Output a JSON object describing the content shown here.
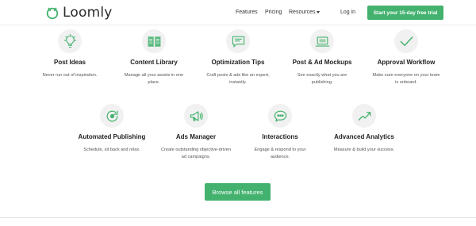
{
  "brand": {
    "name": "Loomly",
    "accent": "#43b26e"
  },
  "nav": {
    "features": "Features",
    "pricing": "Pricing",
    "resources": "Resources",
    "login": "Log in",
    "cta": "Start your 15-day free trial"
  },
  "features_row1": [
    {
      "icon": "lightbulb-icon",
      "title": "Post Ideas",
      "desc": "Never run out of inspiration."
    },
    {
      "icon": "book-icon",
      "title": "Content Library",
      "desc": "Manage all your assets in one place."
    },
    {
      "icon": "chat-tips-icon",
      "title": "Optimization Tips",
      "desc": "Craft posts & ads like an expert, instantly."
    },
    {
      "icon": "laptop-icon",
      "title": "Post & Ad Mockups",
      "desc": "See exactly what you are publishing."
    },
    {
      "icon": "checkmark-icon",
      "title": "Approval Workflow",
      "desc": "Make sure everyone on your team is onboard."
    }
  ],
  "features_row2": [
    {
      "icon": "refresh-icon",
      "title": "Automated Publishing",
      "desc": "Schedule, sit back and relax."
    },
    {
      "icon": "megaphone-icon",
      "title": "Ads Manager",
      "desc": "Create outstanding objective-driven ad campaigns."
    },
    {
      "icon": "speech-bubble-icon",
      "title": "Interactions",
      "desc": "Engage & respond to your audience."
    },
    {
      "icon": "trend-chart-icon",
      "title": "Advanced Analytics",
      "desc": "Measure & build your success."
    }
  ],
  "browse_all": "Browse all features"
}
